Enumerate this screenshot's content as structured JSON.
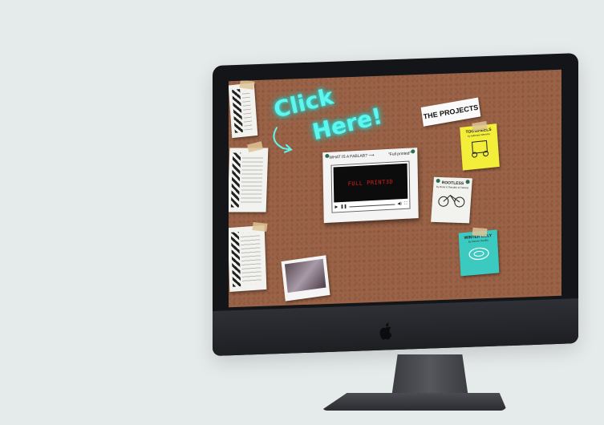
{
  "screen": {
    "neon_line1": "Click",
    "neon_line2": "Here!",
    "projects_title": "THE PROJECTS",
    "video": {
      "header_left": "WHAT IS A FABLAB? ⟶",
      "header_right": "\"Full printed\"",
      "screen_text": "FULL PRINT3D"
    },
    "notes": [
      {
        "title": "TOOWHEELS",
        "subtitle": "by Adrienne Wemme",
        "color": "#f2ee3a"
      },
      {
        "title": "ROOTLESS",
        "subtitle": "by Rene & Ronaldo & Fabricio",
        "color": "#f2f2ee"
      },
      {
        "title": "WINTER LILLY",
        "subtitle": "by Forever Gunilla",
        "color": "#3cc9c0"
      }
    ]
  },
  "colors": {
    "cork": "#9a6246",
    "neon": "#5ff6f0",
    "background": "#e5eaea"
  },
  "icons": [
    "apple-logo-icon",
    "curved-arrow-icon",
    "play-icon",
    "volume-icon",
    "fullscreen-icon"
  ]
}
